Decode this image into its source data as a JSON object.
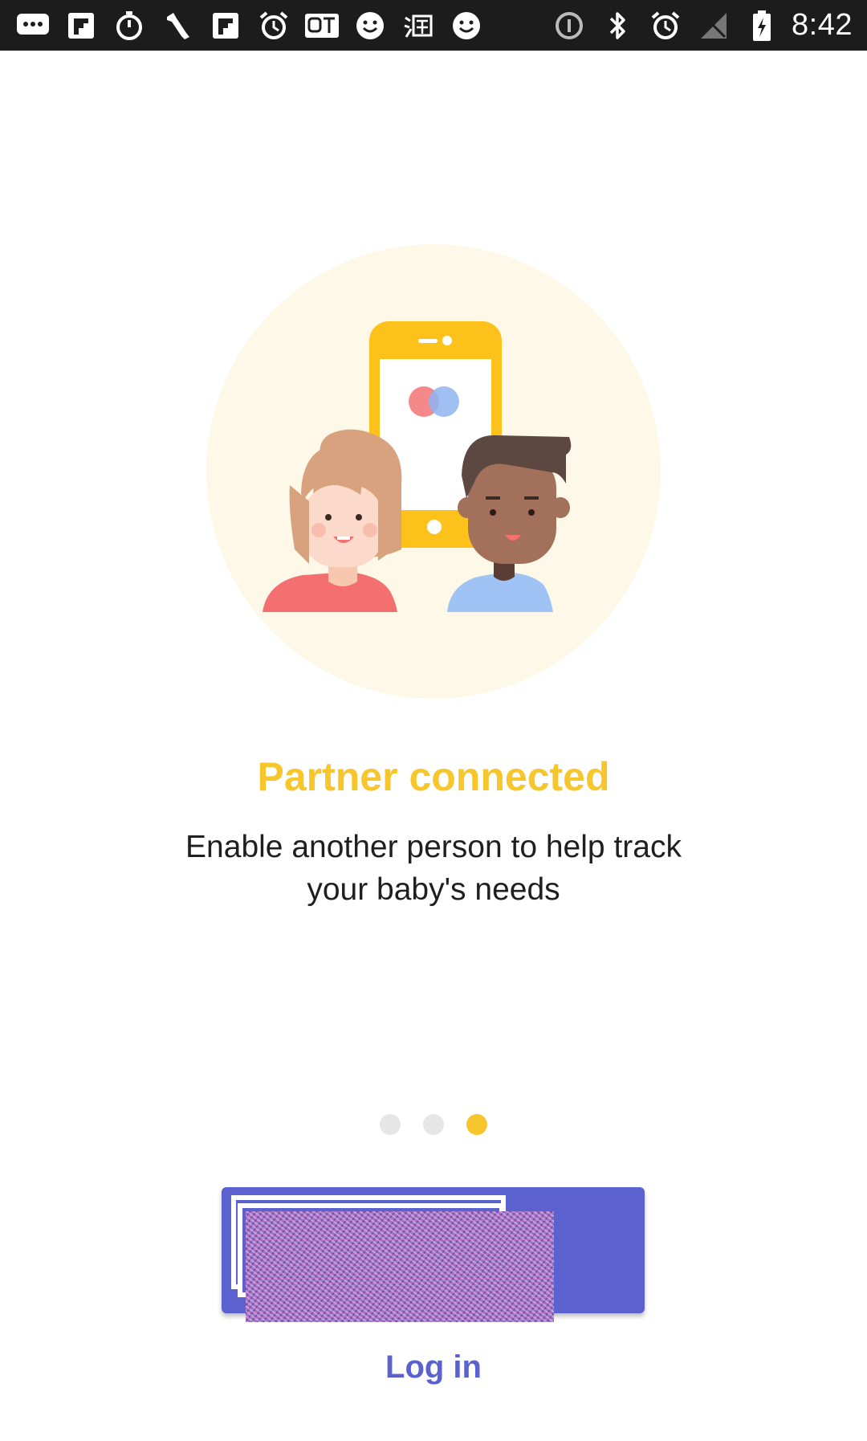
{
  "status_bar": {
    "time": "8:42",
    "left_icons": [
      "message-icon",
      "flipboard-icon",
      "stopwatch-icon",
      "wrench-icon",
      "flipboard-icon",
      "alarm-icon",
      "qt-icon",
      "smiley-icon",
      "taobao-icon",
      "smiley-icon"
    ],
    "right_icons": [
      "info-icon",
      "bluetooth-icon",
      "alarm-icon",
      "signal-off-icon",
      "battery-charging-icon"
    ]
  },
  "onboarding": {
    "title": "Partner connected",
    "description": "Enable another person to help track your baby's needs",
    "page_count": 3,
    "active_page": 3
  },
  "actions": {
    "login_label": "Log in"
  },
  "colors": {
    "accent_yellow": "#f7c52c",
    "primary_purple": "#5b62cf",
    "circle_bg": "#fdf8e8"
  }
}
